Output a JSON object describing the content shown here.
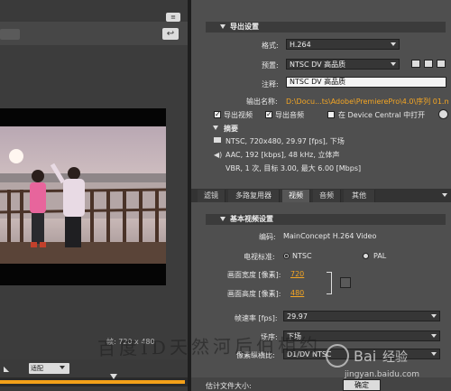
{
  "left": {
    "fit_label": "适配",
    "overlay_size": "帧: 720 x 480"
  },
  "export": {
    "section_title": "导出设置",
    "format_label": "格式:",
    "format_value": "H.264",
    "preset_label": "预置:",
    "preset_value": "NTSC DV 高品质",
    "comment_label": "注释:",
    "comment_value": "NTSC DV 高品质",
    "output_label": "输出名称:",
    "output_value": "D:\\Docu...ts\\Adobe\\PremierePro\\4.0\\序列 01.mp4",
    "export_video": "导出视频",
    "export_audio": "导出音频",
    "open_in_dc": "在 Device Central 中打开"
  },
  "summary": {
    "title": "摘要",
    "video_line": "NTSC, 720x480, 29.97 [fps], 下场",
    "audio_line": "AAC, 192 [kbps], 48 kHz, 立体声",
    "vbr_line": "VBR, 1 次, 目标 3.00, 最大 6.00 [Mbps]"
  },
  "tabs": [
    "滤镜",
    "多路复用器",
    "视频",
    "音频",
    "其他"
  ],
  "basic_video": {
    "title": "基本视频设置",
    "codec_label": "编码:",
    "codec_value": "MainConcept H.264 Video",
    "tv_standard_label": "电视标准:",
    "ntsc": "NTSC",
    "pal": "PAL",
    "width_label": "画面宽度 [像素]:",
    "width_value": "720",
    "height_label": "画面高度 [像素]:",
    "height_value": "480",
    "frame_rate_label": "帧速率 [fps]:",
    "frame_rate_value": "29.97",
    "field_label": "场序:",
    "field_value": "下场",
    "pixel_aspect_label": "像素纵横比:",
    "pixel_aspect_value": "D1/DV NTSC"
  },
  "bottom": {
    "estimate_label": "估计文件大小:",
    "ok_button": "确定"
  },
  "watermark": {
    "text": "百度ID天然河后伯相约",
    "url": "jingyan.baidu.com"
  }
}
